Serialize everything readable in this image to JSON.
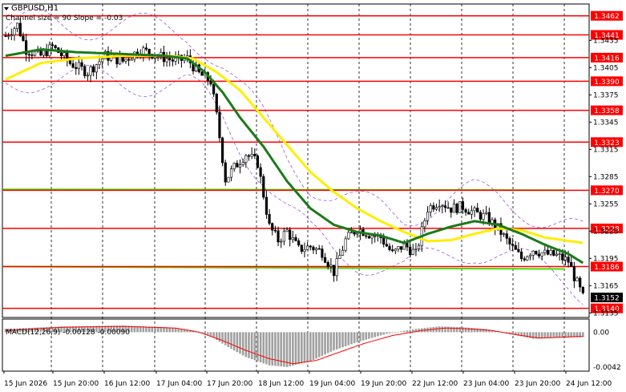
{
  "chart_data": {
    "type": "candlestick",
    "symbol": "GBPUSD,H1",
    "indicator_label": "Channel size = 90 Slope = -0.03",
    "macd_label": "MACD(12,26,9) -0.00128 -0.00090",
    "ylim": [
      1.313,
      1.3475
    ],
    "macd_ylim": [
      -0.0047,
      0.0011
    ],
    "price_ticks": [
      "1.3435",
      "1.3405",
      "1.3375",
      "1.3345",
      "1.3315",
      "1.3285",
      "1.3255",
      "1.3225",
      "1.3195",
      "1.3165",
      "1.3135"
    ],
    "macd_ticks": [
      "0.00",
      "-0.0042"
    ],
    "x_labels": [
      "15 Jun 2026",
      "15 Jun 20:00",
      "16 Jun 12:00",
      "17 Jun 04:00",
      "17 Jun 20:00",
      "18 Jun 12:00",
      "19 Jun 04:00",
      "19 Jun 20:00",
      "22 Jun 12:00",
      "23 Jun 04:00",
      "23 Jun 20:00",
      "24 Jun 12:00"
    ],
    "levels": [
      "1.3462",
      "1.3441",
      "1.3416",
      "1.3390",
      "1.3358",
      "1.3323",
      "1.3270",
      "1.3228",
      "1.3186",
      "1.3140"
    ],
    "current_price": "1.3152",
    "green_lines": [
      1.3271,
      1.3186
    ],
    "close_anchors": [
      [
        0,
        1.344
      ],
      [
        4,
        1.3452
      ],
      [
        7,
        1.3425
      ],
      [
        12,
        1.3418
      ],
      [
        16,
        1.3428
      ],
      [
        22,
        1.341
      ],
      [
        28,
        1.34
      ],
      [
        34,
        1.3418
      ],
      [
        40,
        1.3412
      ],
      [
        46,
        1.3425
      ],
      [
        52,
        1.3418
      ],
      [
        58,
        1.3412
      ],
      [
        62,
        1.3415
      ],
      [
        66,
        1.3398
      ],
      [
        70,
        1.339
      ],
      [
        72,
        1.3352
      ],
      [
        75,
        1.3282
      ],
      [
        78,
        1.3295
      ],
      [
        82,
        1.331
      ],
      [
        86,
        1.33
      ],
      [
        90,
        1.323
      ],
      [
        93,
        1.3215
      ],
      [
        96,
        1.3225
      ],
      [
        100,
        1.3205
      ],
      [
        104,
        1.3208
      ],
      [
        108,
        1.3202
      ],
      [
        112,
        1.318
      ],
      [
        116,
        1.3215
      ],
      [
        120,
        1.3228
      ],
      [
        124,
        1.3222
      ],
      [
        128,
        1.3218
      ],
      [
        132,
        1.32
      ],
      [
        136,
        1.321
      ],
      [
        140,
        1.32
      ],
      [
        144,
        1.325
      ],
      [
        148,
        1.3258
      ],
      [
        152,
        1.325
      ],
      [
        156,
        1.3252
      ],
      [
        160,
        1.3245
      ],
      [
        164,
        1.324
      ],
      [
        168,
        1.3228
      ],
      [
        172,
        1.321
      ],
      [
        176,
        1.3195
      ],
      [
        180,
        1.3205
      ],
      [
        184,
        1.32
      ],
      [
        188,
        1.3198
      ],
      [
        192,
        1.3192
      ],
      [
        194,
        1.3175
      ],
      [
        196,
        1.316
      ],
      [
        197,
        1.3152
      ]
    ],
    "ma_fast": [
      [
        0,
        1.3418
      ],
      [
        12,
        1.3425
      ],
      [
        24,
        1.3422
      ],
      [
        40,
        1.342
      ],
      [
        54,
        1.3418
      ],
      [
        62,
        1.3415
      ],
      [
        68,
        1.34
      ],
      [
        74,
        1.3378
      ],
      [
        80,
        1.335
      ],
      [
        88,
        1.3318
      ],
      [
        96,
        1.328
      ],
      [
        104,
        1.325
      ],
      [
        112,
        1.3232
      ],
      [
        120,
        1.3224
      ],
      [
        128,
        1.322
      ],
      [
        136,
        1.3212
      ],
      [
        144,
        1.3222
      ],
      [
        152,
        1.323
      ],
      [
        160,
        1.3236
      ],
      [
        168,
        1.3232
      ],
      [
        176,
        1.3222
      ],
      [
        184,
        1.321
      ],
      [
        192,
        1.32
      ],
      [
        197,
        1.319
      ]
    ],
    "ma_slow": [
      [
        0,
        1.3392
      ],
      [
        12,
        1.341
      ],
      [
        24,
        1.3415
      ],
      [
        40,
        1.3418
      ],
      [
        56,
        1.3418
      ],
      [
        64,
        1.3415
      ],
      [
        72,
        1.34
      ],
      [
        80,
        1.338
      ],
      [
        88,
        1.335
      ],
      [
        96,
        1.332
      ],
      [
        104,
        1.329
      ],
      [
        112,
        1.3268
      ],
      [
        120,
        1.325
      ],
      [
        128,
        1.3236
      ],
      [
        136,
        1.3224
      ],
      [
        144,
        1.3214
      ],
      [
        152,
        1.3215
      ],
      [
        160,
        1.3222
      ],
      [
        168,
        1.3228
      ],
      [
        176,
        1.3226
      ],
      [
        184,
        1.3218
      ],
      [
        197,
        1.3212
      ]
    ],
    "macd_hist_anchors": [
      [
        0,
        0.0004
      ],
      [
        20,
        0.0007
      ],
      [
        40,
        0.0008
      ],
      [
        55,
        0.0006
      ],
      [
        64,
        0.0002
      ],
      [
        70,
        -0.0005
      ],
      [
        76,
        -0.0018
      ],
      [
        82,
        -0.003
      ],
      [
        90,
        -0.004
      ],
      [
        96,
        -0.0042
      ],
      [
        104,
        -0.0035
      ],
      [
        112,
        -0.0022
      ],
      [
        120,
        -0.0012
      ],
      [
        130,
        -0.0002
      ],
      [
        140,
        0.0004
      ],
      [
        148,
        0.0007
      ],
      [
        156,
        0.0006
      ],
      [
        164,
        0.0004
      ],
      [
        172,
        -0.0002
      ],
      [
        180,
        -0.0008
      ],
      [
        188,
        -0.0007
      ],
      [
        197,
        -0.0006
      ]
    ],
    "macd_signal_anchors": [
      [
        0,
        0.0002
      ],
      [
        20,
        0.0006
      ],
      [
        40,
        0.0007
      ],
      [
        58,
        0.0005
      ],
      [
        66,
        0.0
      ],
      [
        74,
        -0.001
      ],
      [
        82,
        -0.0022
      ],
      [
        90,
        -0.0032
      ],
      [
        98,
        -0.0038
      ],
      [
        106,
        -0.0034
      ],
      [
        114,
        -0.0024
      ],
      [
        122,
        -0.0014
      ],
      [
        132,
        -0.0004
      ],
      [
        142,
        0.0002
      ],
      [
        150,
        0.0005
      ],
      [
        158,
        0.0004
      ],
      [
        166,
        0.0002
      ],
      [
        174,
        -0.0003
      ],
      [
        182,
        -0.0007
      ],
      [
        190,
        -0.0006
      ],
      [
        197,
        -0.0005
      ]
    ],
    "colors": {
      "up": "#000000",
      "down": "#000000",
      "level_line": "#ff0000",
      "level_label_bg": "#ff0000",
      "green_line": "#44dd00",
      "ma_fast": "#1a7a1a",
      "ma_slow": "#ffee00",
      "channel": "#9b59d0",
      "macd_hist": "#a0a0a0",
      "macd_signal": "#ff0000",
      "price_label_bg": "#000000"
    }
  }
}
